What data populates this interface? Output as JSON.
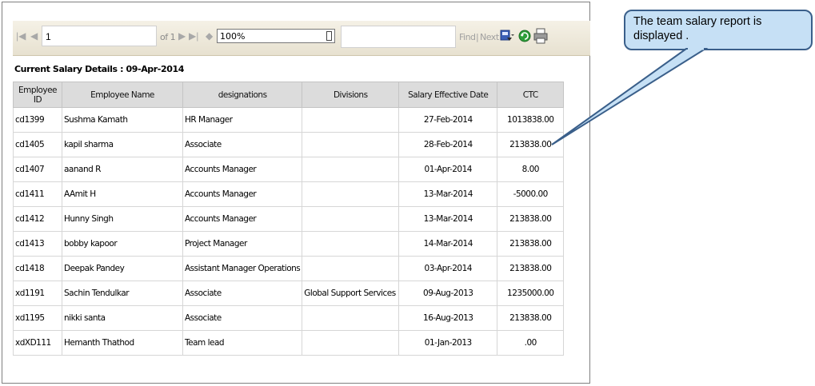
{
  "toolbar": {
    "page_value": "1",
    "of_label": "of 1",
    "zoom_value": "100%",
    "find_label": "Find",
    "separator": "|",
    "next_label": "Next"
  },
  "report": {
    "title": "Current Salary Details : 09-Apr-2014",
    "columns": [
      "Employee ID",
      "Employee Name",
      "designations",
      "Divisions",
      "Salary Effective Date",
      "CTC"
    ],
    "rows": [
      [
        "cd1399",
        "Sushma Kamath",
        "HR Manager",
        "",
        "27-Feb-2014",
        "1013838.00"
      ],
      [
        "cd1405",
        "kapil sharma",
        "Associate",
        "",
        "28-Feb-2014",
        "213838.00"
      ],
      [
        "cd1407",
        "aanand R",
        "Accounts Manager",
        "",
        "01-Apr-2014",
        "8.00"
      ],
      [
        "cd1411",
        "AAmit H",
        "Accounts Manager",
        "",
        "13-Mar-2014",
        "-5000.00"
      ],
      [
        "cd1412",
        "Hunny Singh",
        "Accounts Manager",
        "",
        "13-Mar-2014",
        "213838.00"
      ],
      [
        "cd1413",
        "bobby kapoor",
        "Project Manager",
        "",
        "14-Mar-2014",
        "213838.00"
      ],
      [
        "cd1418",
        "Deepak Pandey",
        "Assistant Manager Operations",
        "",
        "03-Apr-2014",
        "213838.00"
      ],
      [
        "xd1191",
        "Sachin Tendulkar",
        "Associate",
        "Global Support Services",
        "09-Aug-2013",
        "1235000.00"
      ],
      [
        "xd1195",
        "nikki santa",
        "Associate",
        "",
        "16-Aug-2013",
        "213838.00"
      ],
      [
        "xdXD111",
        "Hemanth Thathod",
        "Team lead",
        "",
        "01-Jan-2013",
        ".00"
      ]
    ]
  },
  "callout": {
    "text": "The team salary report is displayed ."
  },
  "icons": {
    "first": "first-page-icon",
    "prev": "previous-page-icon",
    "next": "next-page-icon",
    "last": "last-page-icon",
    "back": "back-icon",
    "export": "export-icon",
    "refresh": "refresh-icon",
    "print": "print-icon"
  },
  "colors": {
    "toolbar_bg": "#ece6d6",
    "header_bg": "#dcdcdc",
    "callout_bg": "#c6e0f5",
    "callout_border": "#3a5f8a",
    "refresh": "#2e9e3a",
    "export": "#3a5fb5"
  }
}
